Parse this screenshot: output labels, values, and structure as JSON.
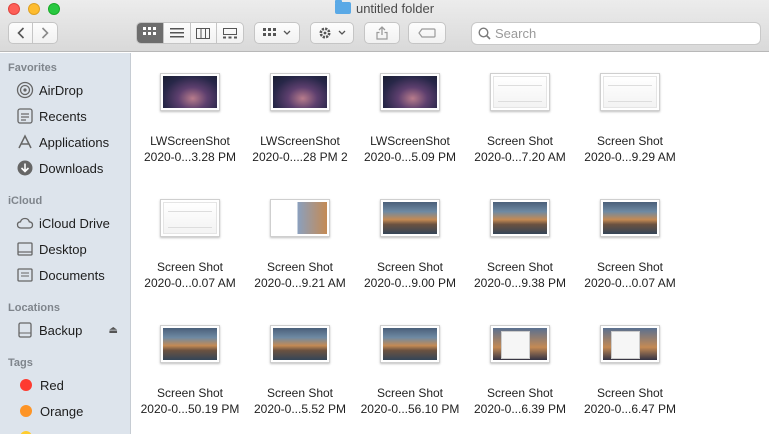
{
  "window": {
    "title": "untitled folder"
  },
  "toolbar": {
    "back_icon": "chevron-left-icon",
    "forward_icon": "chevron-right-icon",
    "views": [
      "icon-view",
      "list-view",
      "column-view",
      "gallery-view"
    ],
    "active_view": "icon-view",
    "group_icon": "grid-group-icon",
    "action_icon": "gear-icon",
    "share_icon": "share-icon",
    "tag_icon": "tag-icon"
  },
  "search": {
    "placeholder": "Search",
    "value": ""
  },
  "sidebar": {
    "favorites_header": "Favorites",
    "favorites": [
      {
        "label": "AirDrop",
        "icon": "airdrop-icon"
      },
      {
        "label": "Recents",
        "icon": "recents-icon"
      },
      {
        "label": "Applications",
        "icon": "applications-icon"
      },
      {
        "label": "Downloads",
        "icon": "downloads-icon"
      }
    ],
    "icloud_header": "iCloud",
    "icloud": [
      {
        "label": "iCloud Drive",
        "icon": "cloud-icon"
      },
      {
        "label": "Desktop",
        "icon": "desktop-icon"
      },
      {
        "label": "Documents",
        "icon": "documents-icon"
      }
    ],
    "locations_header": "Locations",
    "locations": [
      {
        "label": "Backup",
        "icon": "drive-icon",
        "eject": "⏏"
      }
    ],
    "tags_header": "Tags",
    "tags": [
      {
        "label": "Red",
        "color": "#fe3b30"
      },
      {
        "label": "Orange",
        "color": "#fd9426"
      }
    ]
  },
  "files": [
    {
      "line1": "LWScreenShot",
      "line2": "2020-0...3.28 PM",
      "thumb": "purple"
    },
    {
      "line1": "LWScreenShot",
      "line2": "2020-0....28 PM 2",
      "thumb": "purple"
    },
    {
      "line1": "LWScreenShot",
      "line2": "2020-0...5.09 PM",
      "thumb": "purple"
    },
    {
      "line1": "Screen Shot",
      "line2": "2020-0...7.20 AM",
      "thumb": "white"
    },
    {
      "line1": "Screen Shot",
      "line2": "2020-0...9.29 AM",
      "thumb": "white"
    },
    {
      "line1": "Screen Shot",
      "line2": "2020-0...0.07 AM",
      "thumb": "white"
    },
    {
      "line1": "Screen Shot",
      "line2": "2020-0...9.21 AM",
      "thumb": "mixed"
    },
    {
      "line1": "Screen Shot",
      "line2": "2020-0...9.00 PM",
      "thumb": "catalina"
    },
    {
      "line1": "Screen Shot",
      "line2": "2020-0...9.38 PM",
      "thumb": "catalina"
    },
    {
      "line1": "Screen Shot",
      "line2": "2020-0...0.07 AM",
      "thumb": "catalina"
    },
    {
      "line1": "Screen Shot",
      "line2": "2020-0...50.19 PM",
      "thumb": "catalina"
    },
    {
      "line1": "Screen Shot",
      "line2": "2020-0...5.52 PM",
      "thumb": "catalina"
    },
    {
      "line1": "Screen Shot",
      "line2": "2020-0...56.10 PM",
      "thumb": "catalina"
    },
    {
      "line1": "Screen Shot",
      "line2": "2020-0...6.39 PM",
      "thumb": "window"
    },
    {
      "line1": "Screen Shot",
      "line2": "2020-0...6.47 PM",
      "thumb": "window"
    }
  ]
}
